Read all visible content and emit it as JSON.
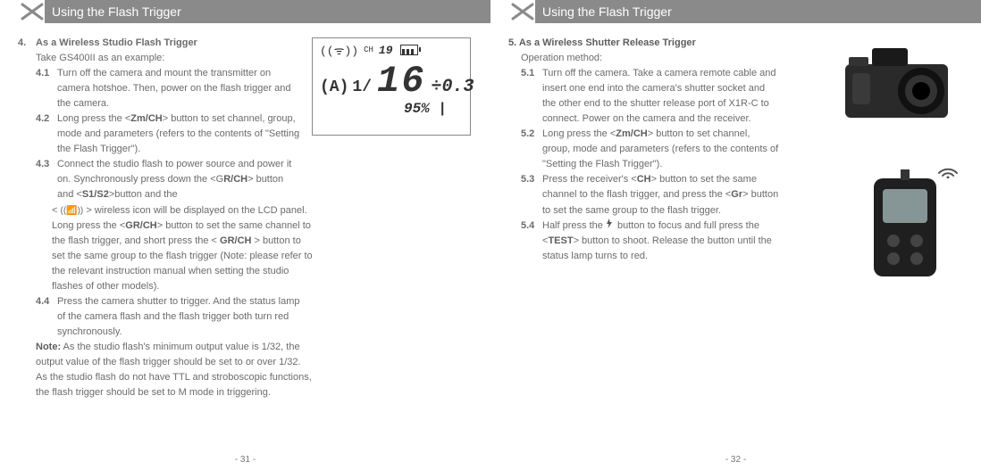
{
  "left": {
    "header": "Using the Flash Trigger",
    "item_num": "4.",
    "item_title": "As a Wireless Studio Flash Trigger",
    "example_line": "Take GS400II as an example:",
    "s41_num": "4.1",
    "s41_text": "Turn off the camera and mount the transmitter on camera hotshoe. Then, power on the flash trigger and the camera.",
    "s42_num": "4.2",
    "s42_pre": "Long press the <",
    "s42_bold": "Zm/CH",
    "s42_post": "> button to set channel, group, mode and parameters (refers to the contents of \"Setting the Flash Trigger\").",
    "s43_num": "4.3",
    "s43_a": "Connect the studio flash to power source and power it on. Synchronously press down the <G",
    "s43_b": "R/CH",
    "s43_c": "> button and <",
    "s43_d": "S1/S2",
    "s43_e": ">button and the",
    "s43_f": "< ",
    "s43_g": " > wireless icon will be displayed on the LCD panel. Long press the <",
    "s43_h": "GR/CH",
    "s43_i": "> button to set the same channel to the flash trigger, and short press the < ",
    "s43_j": "GR/CH",
    "s43_k": " > button to set the same group to the flash trigger (Note: please refer to the relevant instruction manual when setting the studio flashes of other models).",
    "s44_num": "4.4",
    "s44_text": "Press the camera shutter to trigger. And the status lamp of the camera flash and the flash trigger both turn red synchronously.",
    "note_label": "Note:",
    "note_text": " As the studio flash's minimum output value is 1/32, the output value of the flash trigger should be set to or over 1/32. As the studio flash do not have TTL and stroboscopic functions, the flash trigger should be set to M mode in triggering.",
    "pagenum": "- 31 -",
    "lcd": {
      "ch_label": "CH",
      "ch_val": "19",
      "group": "(A)",
      "ratio": "1/",
      "big": "16",
      "small": "÷0.3",
      "pct": "95%"
    }
  },
  "right": {
    "header": "Using the Flash Trigger",
    "item_num": "5.",
    "item_title": " As a Wireless Shutter Release Trigger",
    "op_line": "Operation method:",
    "s51_num": "5.1",
    "s51_text": "Turn off the camera. Take a camera remote cable and insert one end into the camera's shutter socket and the other end to the shutter release port of X1R-C to connect. Power on the camera and the receiver.",
    "s52_num": "5.2",
    "s52_pre": "Long press the <",
    "s52_bold": "Zm/CH",
    "s52_post": "> button to set channel, group, mode and parameters (refers to the contents of \"Setting the Flash Trigger\").",
    "s53_num": "5.3",
    "s53_a": "Press the receiver's <",
    "s53_b": "CH",
    "s53_c": "> button to set the same channel to the flash trigger, and press the <",
    "s53_d": "Gr",
    "s53_e": "> button to set the same group to the flash trigger.",
    "s54_num": "5.4",
    "s54_a": "Half press the ",
    "s54_b": " button to focus and full press the <",
    "s54_c": "TEST",
    "s54_d": "> button to shoot. Release the button until the status lamp turns to red.",
    "pagenum": "- 32 -"
  }
}
